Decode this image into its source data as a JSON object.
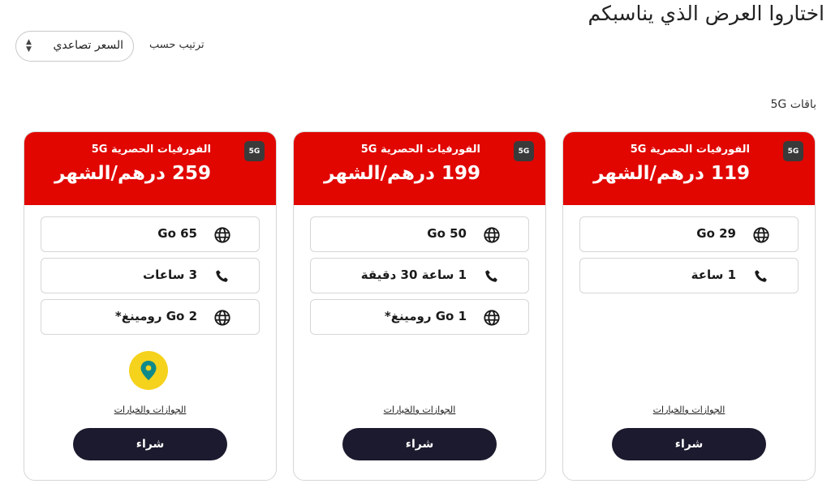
{
  "page": {
    "title": "اختاروا العرض الذي يناسبكم"
  },
  "sort": {
    "label": "ترتيب حسب",
    "value": "السعر تصاعدي"
  },
  "section": {
    "label": "باقات 5G"
  },
  "colors": {
    "brand_red": "#e10600",
    "button_dark": "#1b1a2e",
    "badge_yellow": "#f5d21c"
  },
  "plans": [
    {
      "badge": "5G",
      "title": "الفورفيات الحصرية 5G",
      "price": "119 درهم/الشهر",
      "features": [
        {
          "icon": "globe-icon",
          "text": "29 Go"
        },
        {
          "icon": "phone-icon",
          "text": "1 ساعة"
        }
      ],
      "details": "الجوازات والخيارات",
      "buy": "شراء"
    },
    {
      "badge": "5G",
      "title": "الفورفيات الحصرية 5G",
      "price": "199 درهم/الشهر",
      "features": [
        {
          "icon": "globe-icon",
          "text": "50 Go"
        },
        {
          "icon": "phone-icon",
          "text": "1 ساعة 30 دقيقة"
        },
        {
          "icon": "globe-icon",
          "text": "1 Go رومينغ*"
        }
      ],
      "details": "الجوازات والخيارات",
      "buy": "شراء"
    },
    {
      "badge": "5G",
      "title": "الفورفيات الحصرية 5G",
      "price": "259 درهم/الشهر",
      "features": [
        {
          "icon": "globe-icon",
          "text": "65 Go"
        },
        {
          "icon": "phone-icon",
          "text": "3 ساعات"
        },
        {
          "icon": "globe-icon",
          "text": "2 Go رومينغ*"
        }
      ],
      "extra_icon": "location-pin-icon",
      "details": "الجوازات والخيارات",
      "buy": "شراء"
    }
  ]
}
